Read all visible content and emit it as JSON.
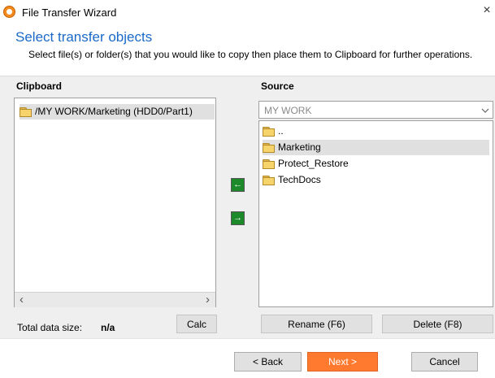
{
  "window": {
    "title": "File Transfer Wizard",
    "close_glyph": "×"
  },
  "header": {
    "heading": "Select transfer objects",
    "description": "Select file(s) or folder(s) that you would like to copy then place them to Clipboard for further operations."
  },
  "clipboard": {
    "label": "Clipboard",
    "items": [
      {
        "name": "/MY WORK/Marketing (HDD0/Part1)",
        "icon": "folder-icon"
      }
    ],
    "scroll_left": "‹",
    "scroll_right": "›"
  },
  "transfer": {
    "to_clipboard_glyph": "←",
    "to_source_glyph": "→"
  },
  "source": {
    "label": "Source",
    "location": "MY WORK",
    "items": [
      {
        "name": "..",
        "icon": "folder-icon"
      },
      {
        "name": "Marketing",
        "icon": "folder-icon",
        "selected": true
      },
      {
        "name": "Protect_Restore",
        "icon": "folder-icon"
      },
      {
        "name": "TechDocs",
        "icon": "folder-icon"
      }
    ]
  },
  "status": {
    "total_label": "Total data size:",
    "total_value": "n/a"
  },
  "buttons": {
    "calc": "Calc",
    "rename": "Rename (F6)",
    "delete": "Delete (F8)",
    "back": "< Back",
    "next": "Next >",
    "cancel": "Cancel"
  },
  "colors": {
    "heading": "#1a69c9",
    "arrow_button": "#1c8a2a",
    "next_button": "#ff7a2f",
    "selection": "#e0e0e0"
  }
}
